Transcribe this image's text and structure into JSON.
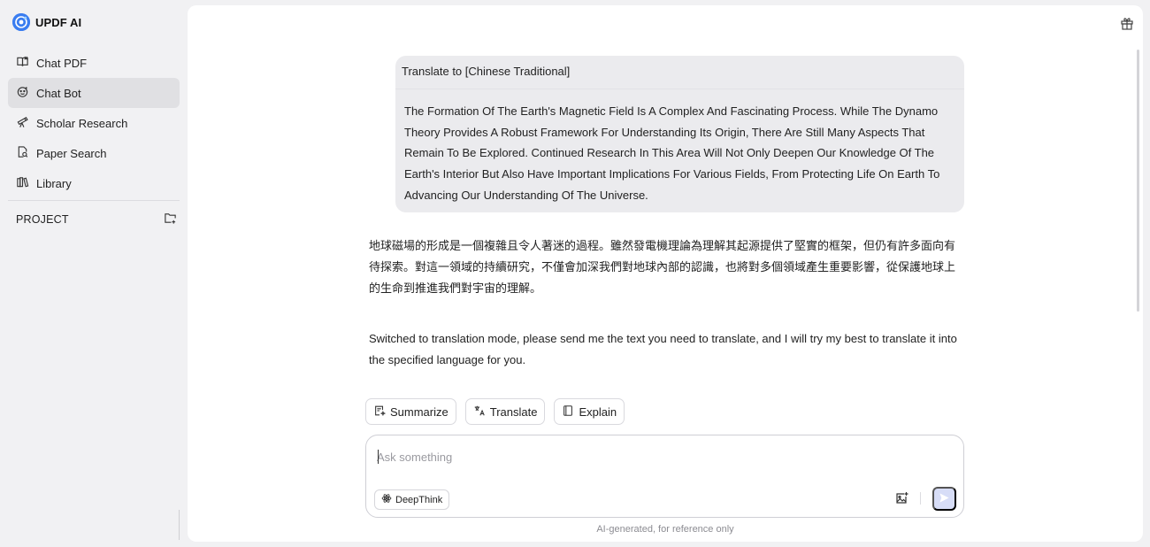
{
  "brand": {
    "name": "UPDF AI"
  },
  "sidebar": {
    "items": [
      {
        "label": "Chat PDF",
        "icon": "book-open-icon",
        "active": false
      },
      {
        "label": "Chat Bot",
        "icon": "bot-face-icon",
        "active": true
      },
      {
        "label": "Scholar Research",
        "icon": "telescope-icon",
        "active": false
      },
      {
        "label": "Paper Search",
        "icon": "document-search-icon",
        "active": false
      },
      {
        "label": "Library",
        "icon": "library-icon",
        "active": false
      }
    ],
    "project_label": "PROJECT"
  },
  "chat": {
    "user_message": {
      "header": "Translate to [Chinese Traditional]",
      "body": "The Formation Of The Earth's Magnetic Field Is A Complex And Fascinating Process. While The Dynamo Theory Provides A Robust Framework For Understanding Its Origin, There Are Still Many Aspects That Remain To Be Explored. Continued Research In This Area Will Not Only Deepen Our Knowledge Of The Earth's Interior But Also Have Important Implications For Various Fields, From Protecting Life On Earth To Advancing Our Understanding Of The Universe."
    },
    "ai_translation": "地球磁場的形成是一個複雜且令人著迷的過程。雖然發電機理論為理解其起源提供了堅實的框架，但仍有許多面向有待探索。對這一領域的持續研究，不僅會加深我們對地球內部的認識，也將對多個領域產生重要影響，從保護地球上的生命到推進我們對宇宙的理解。",
    "ai_mode_message": "Switched to translation mode, please send me the text you need to translate, and I will try my best to translate it into the specified language for you."
  },
  "quick_actions": {
    "summarize": "Summarize",
    "translate": "Translate",
    "explain": "Explain"
  },
  "composer": {
    "placeholder": "Ask something",
    "value": "",
    "deepthink_label": "DeepThink"
  },
  "footer": {
    "disclaimer": "AI-generated, for reference only"
  },
  "colors": {
    "accent": "#3a7df0",
    "send_disabled": "#d7ddf7",
    "bubble": "#ebebee",
    "active_nav": "#e0e0e3"
  }
}
